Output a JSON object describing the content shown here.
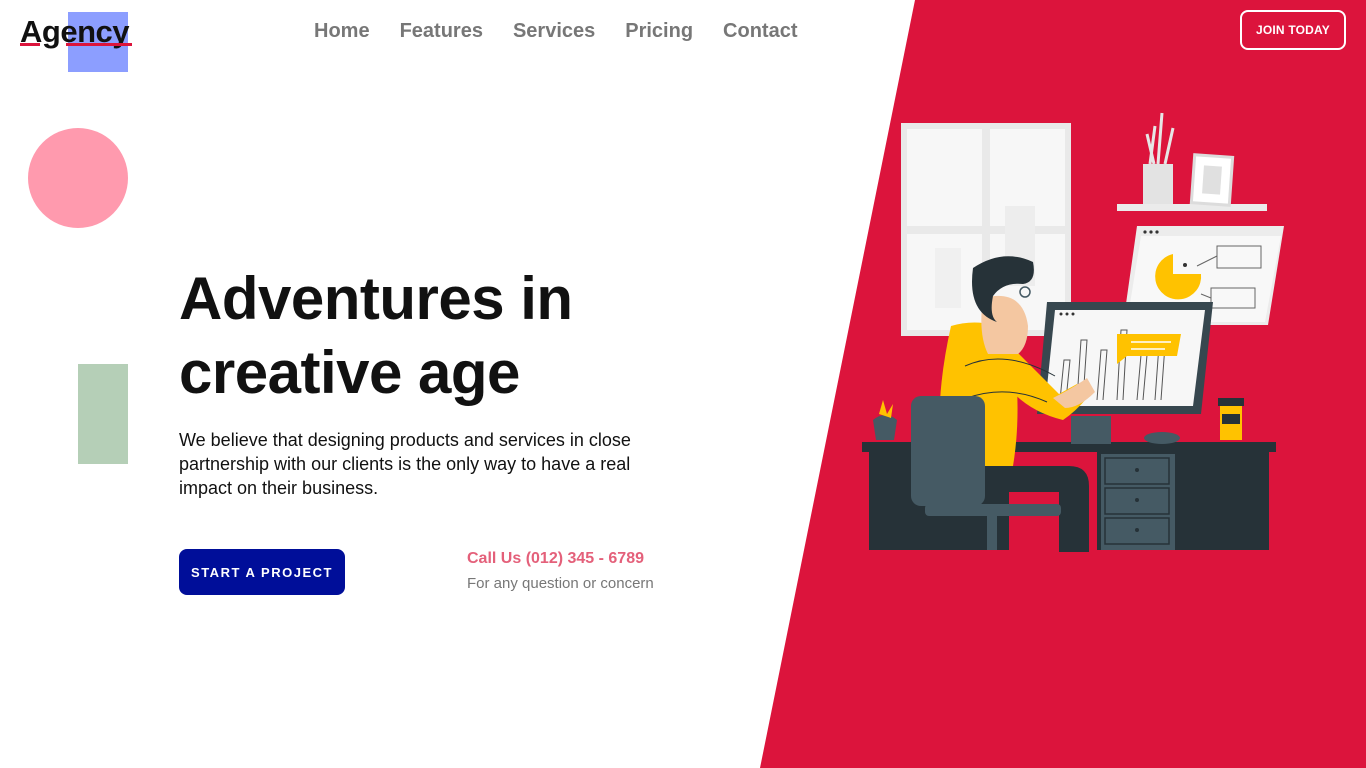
{
  "brand": {
    "logo_text": "Agency"
  },
  "nav": {
    "items": [
      {
        "label": "Home"
      },
      {
        "label": "Features"
      },
      {
        "label": "Services"
      },
      {
        "label": "Pricing"
      },
      {
        "label": "Contact"
      }
    ]
  },
  "header": {
    "cta_label": "JOIN TODAY"
  },
  "hero": {
    "title_line1": "Adventures in",
    "title_line2": "creative age",
    "description": "We believe that designing products and services in close partnership with our clients is the only way to have a real impact on their business.",
    "start_label": "START A PROJECT",
    "call_label": "Call Us (012) 345 - 6789",
    "call_sub": "For any question or concern"
  },
  "colors": {
    "accent_red": "#dc143c",
    "button_blue": "#000e99",
    "logo_square": "#8c9eff",
    "circle_pink": "#ff9aae",
    "rect_green": "#b5cfb7",
    "call_pink": "#e4607a"
  },
  "icons": {
    "illustration": "person-at-desk-illustration"
  }
}
